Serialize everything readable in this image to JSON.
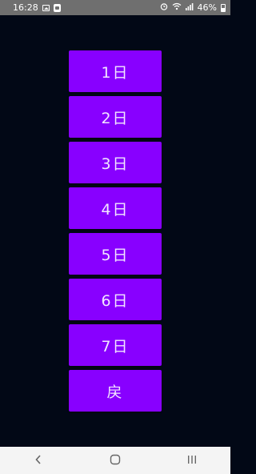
{
  "status_bar": {
    "time": "16:28",
    "battery_percent": "46%",
    "icons_left": [
      "image-icon",
      "sync-icon"
    ],
    "icons_right": [
      "alarm-icon",
      "wifi-icon",
      "signal-icon",
      "battery-icon"
    ]
  },
  "buttons": [
    {
      "label": "1日"
    },
    {
      "label": "2日"
    },
    {
      "label": "3日"
    },
    {
      "label": "4日"
    },
    {
      "label": "5日"
    },
    {
      "label": "6日"
    },
    {
      "label": "7日"
    },
    {
      "label": "戻"
    }
  ],
  "nav_bar": {
    "items": [
      "back-icon",
      "home-icon",
      "recents-icon"
    ]
  },
  "colors": {
    "background": "#020816",
    "button": "#8800ff",
    "button_text": "#f2e6ff",
    "status_bar": "#6f6f6f",
    "nav_bar": "#f4f4f4"
  }
}
